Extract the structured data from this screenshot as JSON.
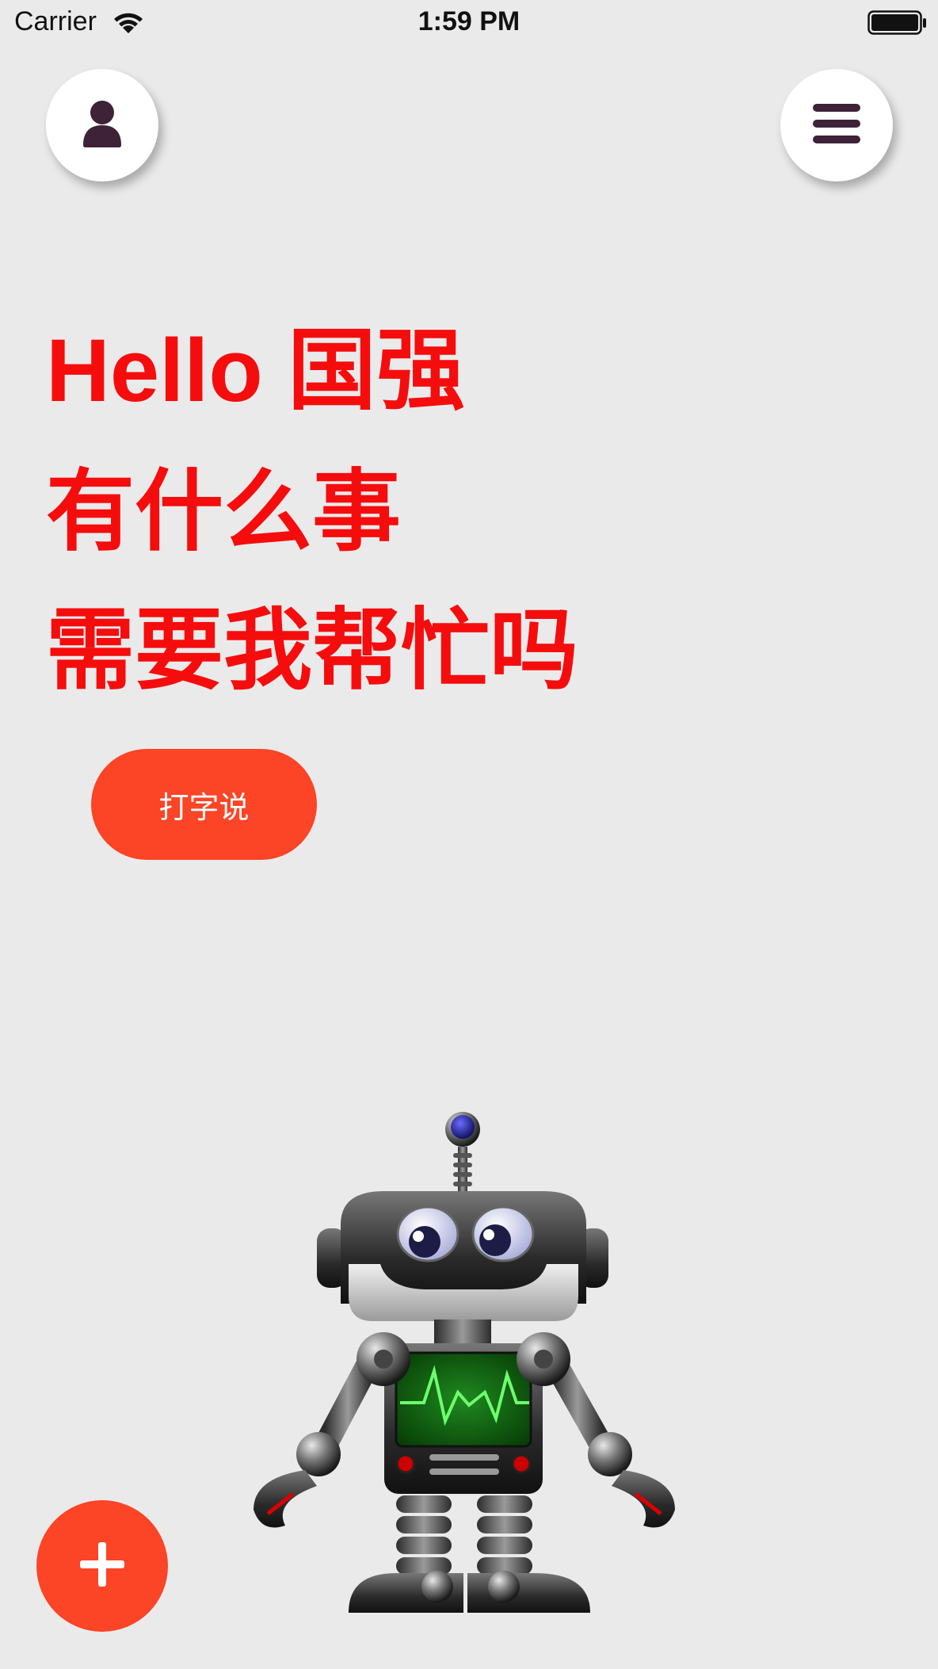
{
  "status_bar": {
    "carrier": "Carrier",
    "time": "1:59 PM"
  },
  "header": {
    "profile_icon": "person-icon",
    "menu_icon": "hamburger-menu-icon"
  },
  "greeting": {
    "line1": "Hello 国强",
    "line2": "有什么事",
    "line3": "需要我帮忙吗"
  },
  "actions": {
    "type_button_label": "打字说",
    "add_icon": "plus-icon"
  },
  "colors": {
    "background": "#ebeaeb",
    "greeting_text": "#f50d0d",
    "accent": "#fc4426",
    "icon_dark": "#3d2238"
  }
}
